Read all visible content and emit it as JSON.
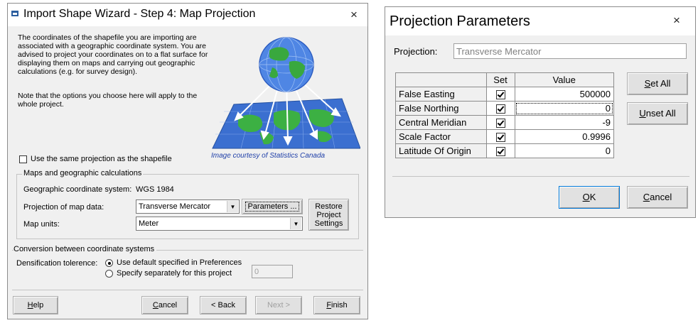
{
  "wizard": {
    "title": "Import Shape Wizard - Step 4: Map Projection",
    "close": "×",
    "intro": "The coordinates of the shapefile you are importing are associated with a geographic coordinate system. You are advised to project your coordinates on to a flat surface for displaying them on maps and carrying out geographic calculations (e.g. for survey design).",
    "note": "Note that the options you choose here will apply to the whole project.",
    "image_caption": "Image courtesy of Statistics Canada",
    "same_projection_label": "Use the same projection as the shapefile",
    "maps_group": {
      "title": "Maps and geographic calculations",
      "gcs_label": "Geographic coordinate system:",
      "gcs_value": "WGS 1984",
      "projection_label": "Projection of map data:",
      "projection_value": "Transverse Mercator",
      "parameters_button": "Parameters ...",
      "units_label": "Map units:",
      "units_value": "Meter",
      "restore_button": [
        "Restore",
        "Project",
        "Settings"
      ]
    },
    "conversion_group": {
      "title": "Conversion between coordinate systems",
      "densification_label": "Densification tolerence:",
      "option_default": "Use default specified in Preferences",
      "option_specify": "Specify separately for this project",
      "tolerance_value": "0"
    },
    "buttons": {
      "help": "Help",
      "cancel": "Cancel",
      "back": "< Back",
      "next": "Next >",
      "finish": "Finish"
    }
  },
  "params_dialog": {
    "title": "Projection Parameters",
    "close": "×",
    "projection_label": "Projection:",
    "projection_value": "Transverse Mercator",
    "table": {
      "headers": [
        "",
        "Set",
        "Value"
      ],
      "rows": [
        {
          "name": "False Easting",
          "set": true,
          "value": "500000"
        },
        {
          "name": "False Northing",
          "set": true,
          "value": "0"
        },
        {
          "name": "Central Meridian",
          "set": true,
          "value": "-9"
        },
        {
          "name": "Scale Factor",
          "set": true,
          "value": "0.9996"
        },
        {
          "name": "Latitude Of Origin",
          "set": true,
          "value": "0"
        }
      ]
    },
    "set_all": "Set All",
    "unset_all": "Unset All",
    "ok": "OK",
    "cancel": "Cancel"
  }
}
